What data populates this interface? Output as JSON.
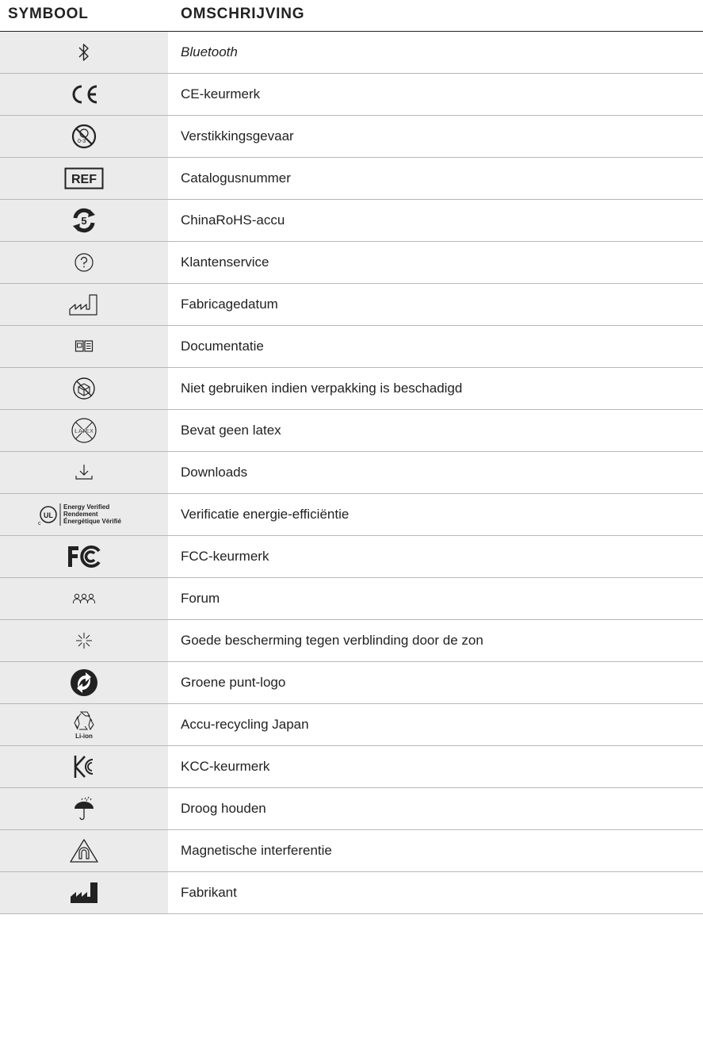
{
  "header": {
    "symbol": "SYMBOOL",
    "description": "OMSCHRIJVING"
  },
  "rows": [
    {
      "icon": "bluetooth-icon",
      "label": "Bluetooth"
    },
    {
      "icon": "ce-mark-icon",
      "label": "CE-keurmerk"
    },
    {
      "icon": "choking-hazard-icon",
      "label": "Verstikkingsgevaar"
    },
    {
      "icon": "ref-icon",
      "label": "Catalogusnummer",
      "icon_text": "REF"
    },
    {
      "icon": "china-rohs-icon",
      "label": "ChinaRoHS-accu",
      "icon_text": "5"
    },
    {
      "icon": "question-icon",
      "label": "Klantenservice"
    },
    {
      "icon": "manufacture-date-icon",
      "label": "Fabricagedatum"
    },
    {
      "icon": "documentation-icon",
      "label": "Documentatie"
    },
    {
      "icon": "damaged-package-icon",
      "label": "Niet gebruiken indien verpakking is beschadigd"
    },
    {
      "icon": "no-latex-icon",
      "label": "Bevat geen latex",
      "icon_text": "LATEX"
    },
    {
      "icon": "download-icon",
      "label": "Downloads"
    },
    {
      "icon": "ul-energy-icon",
      "label": "Verificatie energie-efficiëntie",
      "icon_lines": [
        "Energy Verified",
        "Rendement",
        "Énergétique Vérifié"
      ],
      "icon_text": "UL",
      "icon_small": "c"
    },
    {
      "icon": "fcc-icon",
      "label": "FCC-keurmerk"
    },
    {
      "icon": "forum-icon",
      "label": "Forum"
    },
    {
      "icon": "sun-glare-icon",
      "label": "Goede bescherming tegen verblinding door de zon"
    },
    {
      "icon": "green-dot-icon",
      "label": "Groene punt-logo"
    },
    {
      "icon": "li-ion-recycling-icon",
      "label": "Accu-recycling Japan",
      "icon_text": "Li-ion"
    },
    {
      "icon": "kcc-icon",
      "label": "KCC-keurmerk"
    },
    {
      "icon": "keep-dry-icon",
      "label": "Droog houden"
    },
    {
      "icon": "magnetic-interference-icon",
      "label": "Magnetische interferentie"
    },
    {
      "icon": "manufacturer-icon",
      "label": "Fabrikant"
    }
  ]
}
